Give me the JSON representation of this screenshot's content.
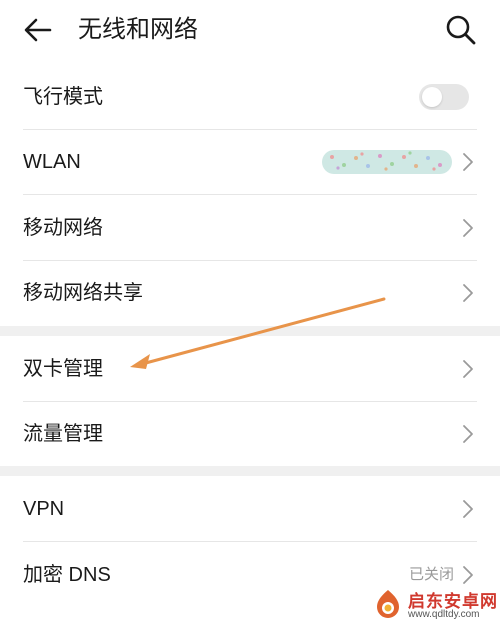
{
  "header": {
    "title": "无线和网络",
    "back_icon": "back-arrow-icon",
    "search_icon": "search-icon"
  },
  "rows": [
    {
      "label": "飞行模式",
      "control": "toggle",
      "toggle_on": false
    },
    {
      "label": "WLAN",
      "value": "",
      "control": "chevron"
    },
    {
      "label": "移动网络",
      "control": "chevron"
    },
    {
      "label": "移动网络共享",
      "control": "chevron"
    },
    {
      "label": "双卡管理",
      "control": "chevron"
    },
    {
      "label": "流量管理",
      "control": "chevron"
    },
    {
      "label": "VPN",
      "control": "chevron"
    },
    {
      "label": "加密 DNS",
      "value": "已关闭",
      "control": "chevron"
    }
  ],
  "annotation": {
    "color": "#e8944a",
    "target": "双卡管理"
  },
  "watermark": {
    "title": "启东安卓网",
    "url": "www.qdltdy.com"
  },
  "colors": {
    "divider": "#e6e6e6",
    "section_gap": "#f0f0f0",
    "chevron": "#9a9a9a"
  }
}
